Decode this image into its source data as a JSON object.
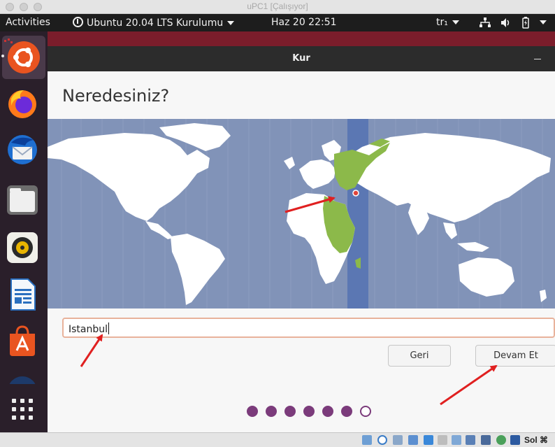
{
  "host_window": {
    "title": "uPC1 [Çalışıyor]"
  },
  "topbar": {
    "activities": "Activities",
    "app_menu": "Ubuntu 20.04 LTS Kurulumu",
    "clock": "Haz 20  22:51",
    "keyboard_layout": "tr₁"
  },
  "dock": {
    "items": [
      "ubuntu-installer",
      "firefox",
      "thunderbird",
      "files",
      "rhythmbox",
      "libreoffice-writer",
      "ubuntu-software",
      "help",
      "show-applications"
    ]
  },
  "window": {
    "title": "Kur",
    "heading": "Neredesiniz?"
  },
  "timezone": {
    "value": "Istanbul",
    "selected_highlight_color": "#8cb94a",
    "selected_marker_color": "#e0443a"
  },
  "buttons": {
    "back_label": "Geri",
    "continue_label": "Devam Et"
  },
  "progress": {
    "total_steps": 7,
    "current_step": 7,
    "filled_color": "#7b3b7b"
  },
  "vbox_status": {
    "host_key": "Sol ⌘"
  },
  "annotations": {
    "arrow_color": "#e02020"
  }
}
